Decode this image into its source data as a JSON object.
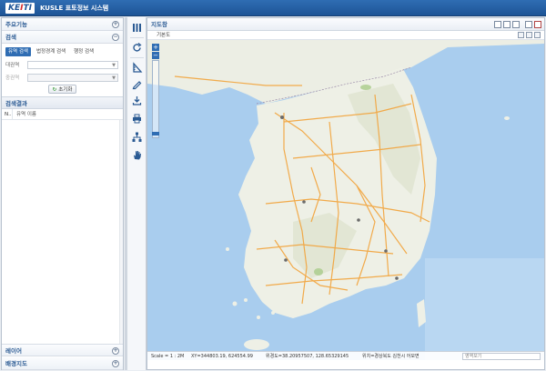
{
  "app": {
    "logo_main": "KE",
    "logo_em": "I",
    "logo_tail": "TI",
    "title": "KUSLE 표토정보 시스템"
  },
  "left_panel": {
    "main_functions": "주요기능",
    "search": {
      "header": "검색",
      "tabs": [
        "유역 검색",
        "법정경계 검색",
        "행정 검색"
      ],
      "active_tab": 0,
      "field1_label": "대권역",
      "field1_value": "",
      "field2_label": "중권역",
      "field2_value": "",
      "reset_label": "초기화"
    },
    "results": {
      "header": "검색결과",
      "col_no": "N..",
      "col_name": "유역 이름"
    },
    "layer_header": "레이어",
    "background_header": "배경지도"
  },
  "map_panel": {
    "header": "지도창",
    "basemap_label": "기본도",
    "status": {
      "scale": "Scale = 1 : 2M",
      "xy": "XY=344803.19, 624554.99",
      "latlon": "위경도=38.20957507, 128.65329145",
      "location": "위치=경상북도 김천시 어모면",
      "place_placeholder": "영역보기"
    }
  },
  "icons": {
    "toolbar": [
      "layers-icon",
      "refresh-icon",
      "measure-icon",
      "edit-icon",
      "download-icon",
      "print-icon",
      "network-icon",
      "hand-icon"
    ]
  },
  "colors": {
    "brand_blue": "#1d5496",
    "accent": "#2f6db3",
    "sea": "#a9cdee",
    "land": "#eef0e6",
    "road": "#f2a33a"
  }
}
